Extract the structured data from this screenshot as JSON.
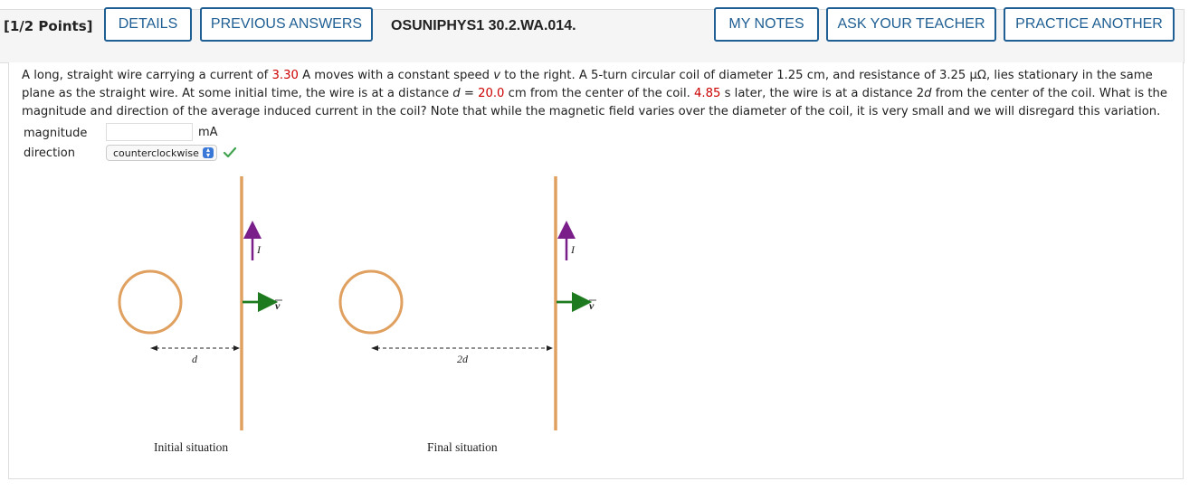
{
  "header": {
    "points": "[1/2 Points]",
    "details_label": "DETAILS",
    "previous_answers_label": "PREVIOUS ANSWERS",
    "question_id": "OSUNIPHYS1 30.2.WA.014.",
    "my_notes_label": "MY NOTES",
    "ask_teacher_label": "ASK YOUR TEACHER",
    "practice_another_label": "PRACTICE ANOTHER"
  },
  "question": {
    "p1": "A long, straight wire carrying a current of ",
    "current": "3.30",
    "p2": " A moves with a constant speed ",
    "v": "v",
    "p3": " to the right. A 5-turn circular coil of diameter 1.25 cm, and resistance of 3.25 μΩ, lies stationary in the same plane as the straight wire. At some initial time, the wire is at a distance ",
    "d": "d",
    "p4": " = ",
    "distance": "20.0",
    "p5": " cm from the center of the coil. ",
    "time": "4.85",
    "p6": " s later, the wire is at a distance 2",
    "d2": "d",
    "p7": " from the center of the coil. What is the magnitude and direction of the average induced current in the coil? Note that while the magnetic field varies over the diameter of the coil, it is very small and we will disregard this variation."
  },
  "answers": {
    "magnitude_label": "magnitude",
    "magnitude_value": "",
    "magnitude_unit": "mA",
    "direction_label": "direction",
    "direction_value": "counterclockwise",
    "direction_status": "correct"
  },
  "figure": {
    "current_label": "I",
    "velocity_label": "v",
    "initial_distance_label": "d",
    "final_distance_label": "2d",
    "initial_caption": "Initial situation",
    "final_caption": "Final situation"
  },
  "colors": {
    "button_blue": "#1f5f93",
    "highlight_red": "#cc0000",
    "wire": "#e0a060",
    "current_arrow": "#7a1f8a",
    "velocity_arrow": "#1e7a1e",
    "check": "#3fa34d"
  }
}
